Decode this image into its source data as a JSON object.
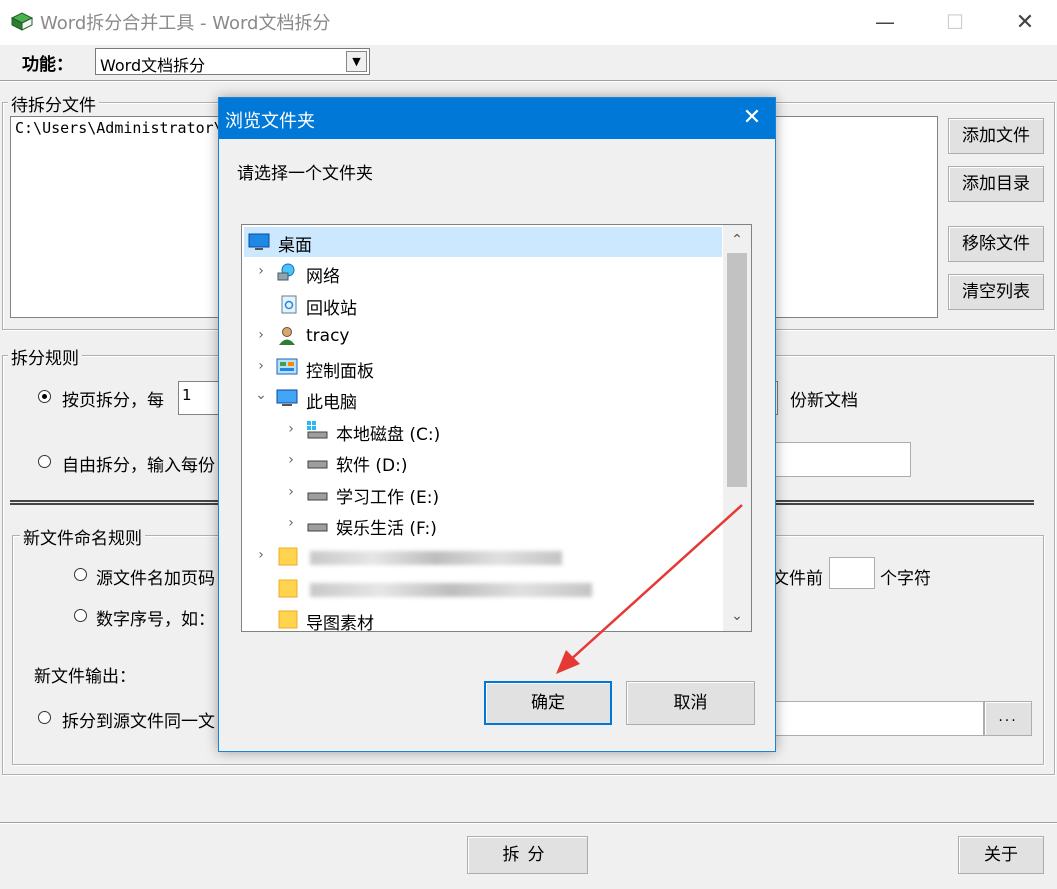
{
  "window": {
    "title": "Word拆分合并工具 - Word文档拆分",
    "min_glyph": "—",
    "max_glyph": "☐",
    "close_glyph": "✕"
  },
  "function": {
    "label": "功能：",
    "selected": "Word文档拆分",
    "arrow": "▼"
  },
  "files": {
    "legend": "待拆分文件",
    "path": "C:\\Users\\Administrator\\",
    "buttons": {
      "add_file": "添加文件",
      "add_dir": "添加目录",
      "remove": "移除文件",
      "clear": "清空列表"
    }
  },
  "rules": {
    "legend": "拆分规则",
    "by_page": "按页拆分，每",
    "pages_value": "1",
    "new_doc": "份新文档",
    "free": "自由拆分，输入每份"
  },
  "naming": {
    "legend": "新文件命名规则",
    "src_page": "源文件名加页码",
    "before": "文件前",
    "chars": "个字符",
    "number": "数字序号，如：",
    "output_label": "新文件输出：",
    "same_dir": "拆分到源文件同一文",
    "browse": "..."
  },
  "actions": {
    "split": "拆分",
    "about": "关于"
  },
  "dialog": {
    "title": "浏览文件夹",
    "close_glyph": "✕",
    "prompt": "请选择一个文件夹",
    "tree": {
      "desktop": "桌面",
      "network": "网络",
      "recycle": "回收站",
      "user": "tracy",
      "control_panel": "控制面板",
      "this_pc": "此电脑",
      "drive_c": "本地磁盘 (C:)",
      "drive_d": "软件 (D:)",
      "drive_e": "学习工作 (E:)",
      "drive_f": "娱乐生活 (F:)",
      "mind_map": "导图素材"
    },
    "ok": "确定",
    "cancel": "取消",
    "chev_right": "›",
    "chev_down": "⌄",
    "scroll_up": "⌃",
    "scroll_down": "⌄"
  },
  "colors": {
    "accent": "#0078d7",
    "selection": "#cce8ff",
    "arrow": "#e53935"
  }
}
